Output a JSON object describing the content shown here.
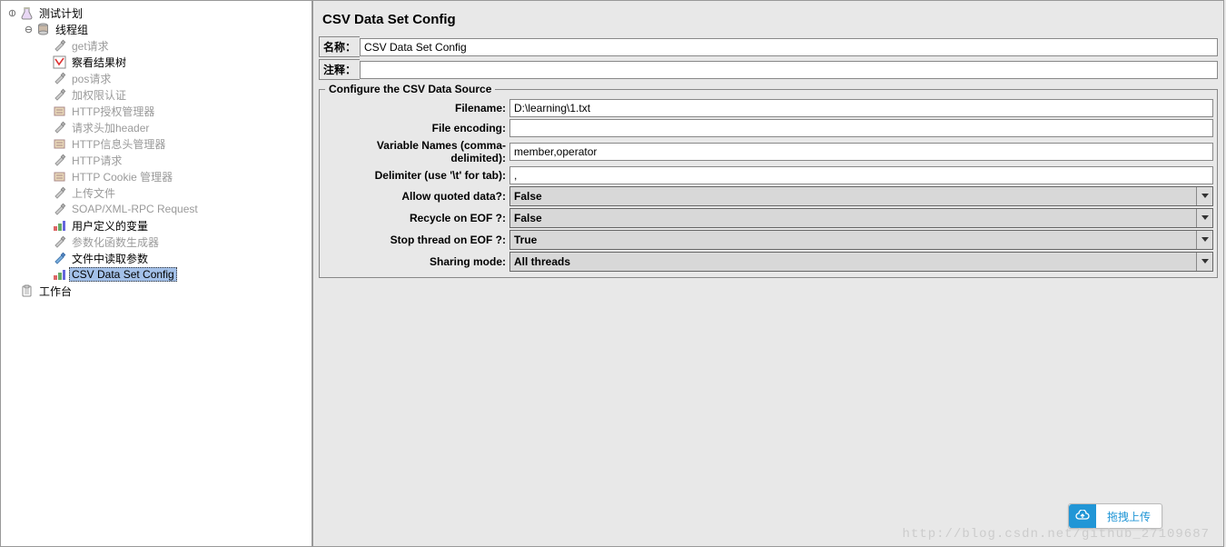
{
  "tree": {
    "root": {
      "label": "测试计划"
    },
    "thread_group": {
      "label": "线程组"
    },
    "children": [
      {
        "label": "get请求",
        "icon": "sampler",
        "grey": true
      },
      {
        "label": "察看结果树",
        "icon": "result-tree",
        "grey": false
      },
      {
        "label": "pos请求",
        "icon": "sampler",
        "grey": true
      },
      {
        "label": "加权限认证",
        "icon": "sampler",
        "grey": true
      },
      {
        "label": "HTTP授权管理器",
        "icon": "config",
        "grey": true
      },
      {
        "label": "请求头加header",
        "icon": "sampler",
        "grey": true
      },
      {
        "label": "HTTP信息头管理器",
        "icon": "config",
        "grey": true
      },
      {
        "label": "HTTP请求",
        "icon": "sampler",
        "grey": true
      },
      {
        "label": "HTTP Cookie 管理器",
        "icon": "config",
        "grey": true
      },
      {
        "label": "上传文件",
        "icon": "sampler",
        "grey": true
      },
      {
        "label": "SOAP/XML-RPC Request",
        "icon": "sampler",
        "grey": true
      },
      {
        "label": "用户定义的变量",
        "icon": "testbench",
        "grey": false
      },
      {
        "label": "参数化函数生成器",
        "icon": "sampler",
        "grey": true
      },
      {
        "label": "文件中读取参数",
        "icon": "sampler-blue",
        "grey": false
      },
      {
        "label": "CSV Data Set Config",
        "icon": "testbench",
        "grey": false,
        "selected": true
      }
    ],
    "workbench": {
      "label": "工作台"
    }
  },
  "panel": {
    "title": "CSV Data Set Config",
    "name_label": "名称：",
    "name_value": "CSV Data Set Config",
    "comment_label": "注释：",
    "comment_value": "",
    "fieldset_title": "Configure the CSV Data Source",
    "rows": {
      "filename_label": "Filename:",
      "filename_value": "D:\\learning\\1.txt",
      "encoding_label": "File encoding:",
      "encoding_value": "",
      "varnames_label": "Variable Names (comma-delimited):",
      "varnames_value": "member,operator",
      "delimiter_label": "Delimiter (use '\\t' for tab):",
      "delimiter_value": ",",
      "allow_quoted_label": "Allow quoted data?:",
      "allow_quoted_value": "False",
      "recycle_label": "Recycle on EOF ?:",
      "recycle_value": "False",
      "stop_label": "Stop thread on EOF ?:",
      "stop_value": "True",
      "sharing_label": "Sharing mode:",
      "sharing_value": "All threads"
    }
  },
  "upload_button": "拖拽上传",
  "watermark": "http://blog.csdn.net/github_27109687"
}
